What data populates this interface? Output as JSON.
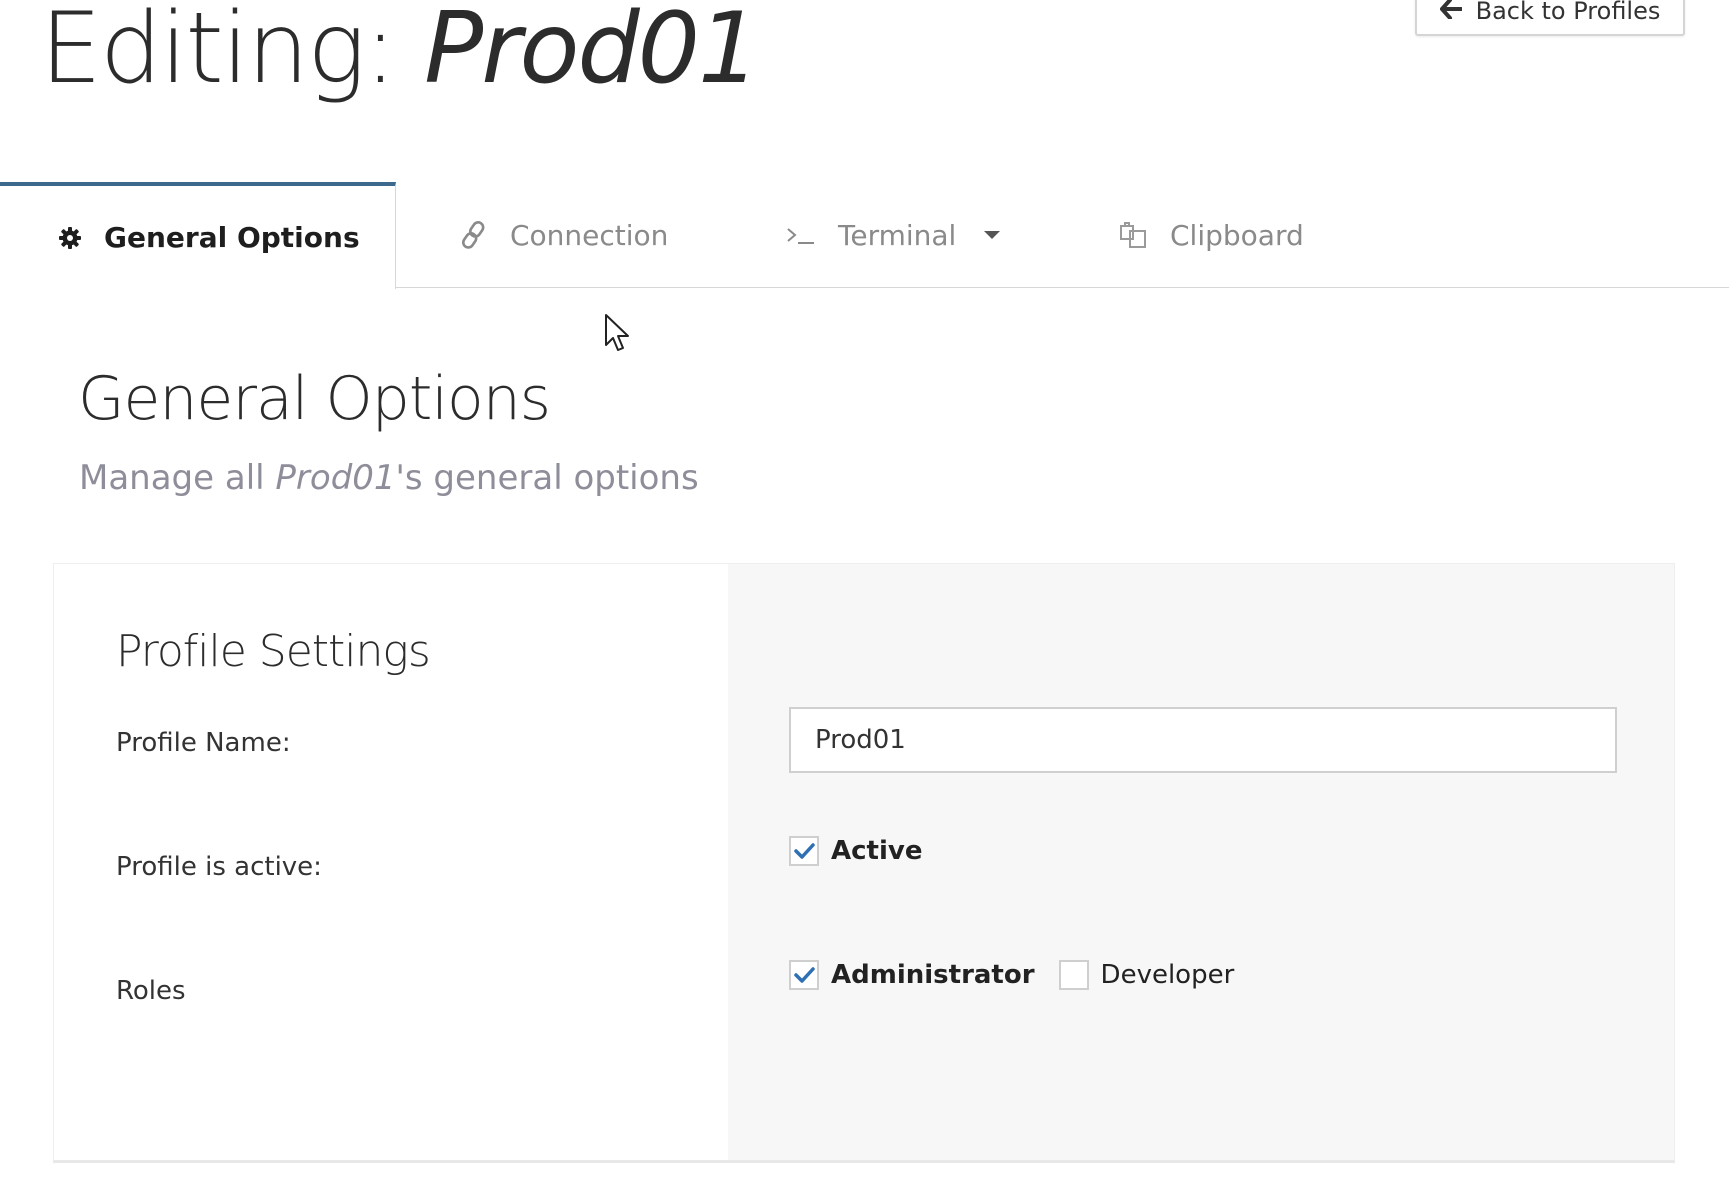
{
  "header": {
    "title_prefix": "Editing: ",
    "title_profile": "Prod01",
    "back_label": "Back to Profiles",
    "back_icon": "arrow-left-icon"
  },
  "tabs": [
    {
      "label": "General Options",
      "icon": "gear-icon",
      "active": true
    },
    {
      "label": "Connection",
      "icon": "link-icon",
      "active": false
    },
    {
      "label": "Terminal",
      "icon": "terminal-icon",
      "active": false,
      "has_dropdown": true
    },
    {
      "label": "Clipboard",
      "icon": "clipboard-icon",
      "active": false
    }
  ],
  "section": {
    "title": "General Options",
    "subtitle_prefix": "Manage all ",
    "subtitle_profile": "Prod01",
    "subtitle_suffix": "'s general options"
  },
  "panel": {
    "title": "Profile Settings",
    "profile_name": {
      "label": "Profile Name:",
      "value": "Prod01"
    },
    "active": {
      "label": "Profile is active:",
      "option": "Active",
      "checked": true
    },
    "roles": {
      "label": "Roles",
      "options": [
        {
          "label": "Administrator",
          "checked": true
        },
        {
          "label": "Developer",
          "checked": false
        }
      ]
    }
  },
  "colors": {
    "accent": "#3d6a8c",
    "check": "#2f6fb3",
    "panel_right_bg": "#f7f7f7",
    "muted_text": "#8e8e9a"
  }
}
